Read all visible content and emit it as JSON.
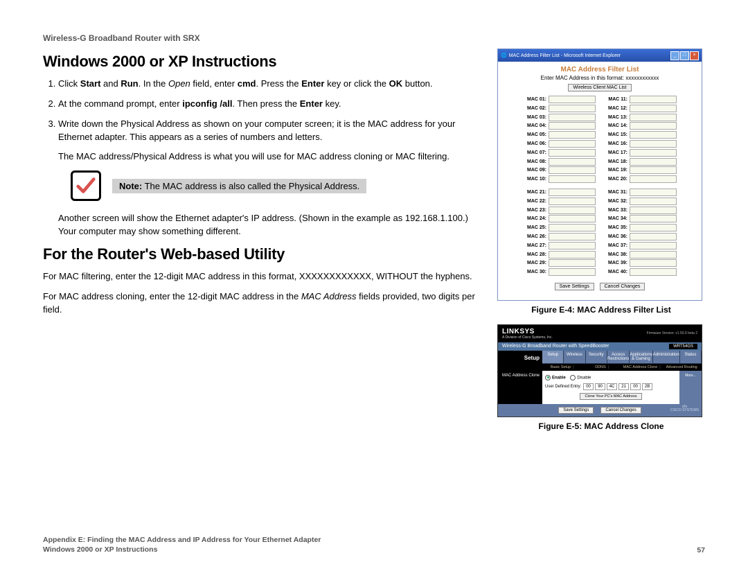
{
  "doc_header": "Wireless-G Broadband Router with SRX",
  "section1_title": "Windows 2000 or XP Instructions",
  "steps": {
    "s1": {
      "t0": "Click ",
      "b1": "Start",
      "t1": " and ",
      "b2": "Run",
      "t2": ". In the ",
      "i1": "Open",
      "t3": " field, enter ",
      "b3": "cmd",
      "t4": ". Press the ",
      "b4": "Enter",
      "t5": " key or click the ",
      "b5": "OK",
      "t6": " button."
    },
    "s2": {
      "t0": "At the command prompt, enter ",
      "b1": "ipconfig /all",
      "t1": ". Then press the ",
      "b2": "Enter",
      "t2": " key."
    },
    "s3": "Write down the Physical Address as shown on your computer screen; it is the MAC address for your Ethernet adapter. This appears as a series of numbers and letters."
  },
  "after_steps_p": "The MAC address/Physical Address is what you will use for MAC address cloning or MAC filtering.",
  "note": {
    "b": "Note:",
    "t": " The MAC address is also called the Physical Address."
  },
  "after_note_p": "Another screen will show the Ethernet adapter's IP address. (Shown in the example as 192.168.1.100.) Your computer may show something different.",
  "section2_title": "For the Router's Web-based Utility",
  "p_filter": "For MAC filtering, enter the 12-digit MAC address in this format, XXXXXXXXXXXX, WITHOUT the hyphens.",
  "p_clone": {
    "t0": "For MAC address cloning, enter the 12-digit MAC address in the ",
    "i1": "MAC Address",
    "t1": " fields provided, two digits per field."
  },
  "figE4": {
    "win_title": "MAC Address Filter List - Microsoft Internet Explorer",
    "heading": "MAC Address Filter List",
    "sub": "Enter MAC Address in this format: xxxxxxxxxxxx",
    "btn_list": "Wireless Client MAC List",
    "labels_left": [
      "MAC 01:",
      "MAC 02:",
      "MAC 03:",
      "MAC 04:",
      "MAC 05:",
      "MAC 06:",
      "MAC 07:",
      "MAC 08:",
      "MAC 09:",
      "MAC 10:"
    ],
    "labels_right": [
      "MAC 11:",
      "MAC 12:",
      "MAC 13:",
      "MAC 14:",
      "MAC 15:",
      "MAC 16:",
      "MAC 17:",
      "MAC 18:",
      "MAC 19:",
      "MAC 20:"
    ],
    "labels_left2": [
      "MAC 21:",
      "MAC 22:",
      "MAC 23:",
      "MAC 24:",
      "MAC 25:",
      "MAC 26:",
      "MAC 27:",
      "MAC 28:",
      "MAC 29:",
      "MAC 30:"
    ],
    "labels_right2": [
      "MAC 31:",
      "MAC 32:",
      "MAC 33:",
      "MAC 34:",
      "MAC 35:",
      "MAC 36:",
      "MAC 37:",
      "MAC 38:",
      "MAC 39:",
      "MAC 40:"
    ],
    "save": "Save Settings",
    "cancel": "Cancel Changes",
    "caption": "Figure E-4: MAC Address Filter List"
  },
  "figE5": {
    "logo": "LINKSYS",
    "logo_sub": "A Division of Cisco Systems, Inc.",
    "fw": "Firmware Version: v1.50.9 beta 2",
    "band_title": "Wireless-G Broadband Router with SpeedBooster",
    "model": "WRT54GS",
    "side": "Setup",
    "tabs": [
      "Setup",
      "Wireless",
      "Security",
      "Access Restrictions",
      "Applications & Gaming",
      "Administration",
      "Status"
    ],
    "subtabs": [
      "Basic Setup",
      "DDNS",
      "MAC Address Clone",
      "Advanced Routing"
    ],
    "content_label": "MAC Address Clone",
    "enable": "Enable",
    "disable": "Disable",
    "ude_label": "User Defined Entry:",
    "ude": [
      "00",
      "90",
      "4C",
      "21",
      "00",
      "2B"
    ],
    "clone_btn": "Clone Your PC's MAC Address",
    "help": "More...",
    "save": "Save Settings",
    "cancel": "Cancel Changes",
    "cisco": "CISCO SYSTEMS",
    "caption": "Figure E-5: MAC Address Clone"
  },
  "footer": {
    "line1": "Appendix E: Finding the MAC Address and IP Address for Your Ethernet Adapter",
    "line2": "Windows 2000 or XP Instructions",
    "page": "57"
  }
}
